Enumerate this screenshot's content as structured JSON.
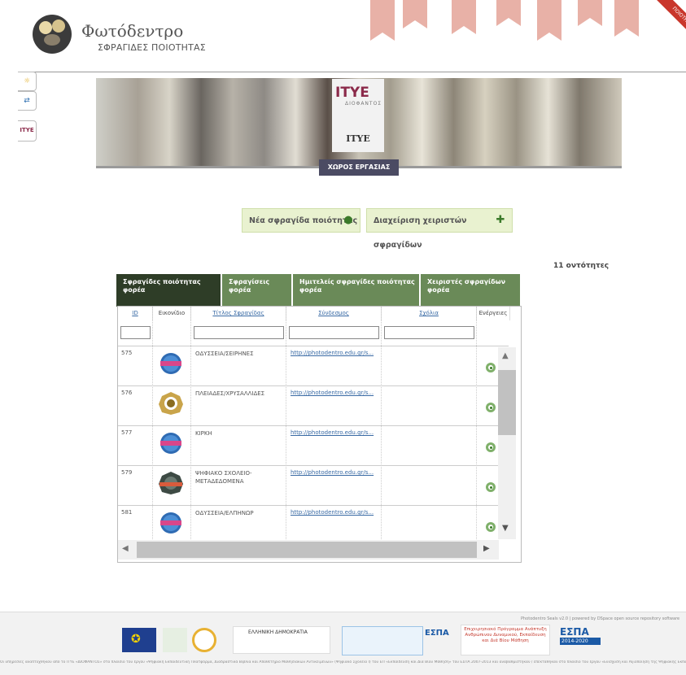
{
  "header": {
    "site_title": "Φωτόδεντρο",
    "site_subtitle": "ΣΦΡΑΓΙΔΕΣ ΠΟΙΟΤΗΤΑΣ",
    "corner_label": "ΠΟΙΟΤΗΤΑ"
  },
  "side_tabs": [
    {
      "icon": "sun-icon"
    },
    {
      "icon": "exchange-icon"
    },
    {
      "label": "ITYE"
    }
  ],
  "banner": {
    "logo_text": "ITYE",
    "logo_subtext": "ΔΙΟΦΑΝΤΟΣ",
    "name": "ITYE",
    "workspace_label": "ΧΩΡΟΣ ΕΡΓΑΣΙΑΣ"
  },
  "actions": {
    "new_seal": "Νέα σφραγίδα ποιότητας",
    "manage_users": "Διαχείριση χειριστών σφραγίδων"
  },
  "count_label": "11 οντότητες",
  "tabs": [
    "Σφραγίδες ποιότητας φορέα",
    "Σφραγίσεις φορέα",
    "Ημιτελείς σφραγίδες ποιότητας φορέα",
    "Χειριστές σφραγίδων φορέα"
  ],
  "grid": {
    "columns": [
      "ID",
      "Εικονίδιο",
      "Τίτλος Σφραγίδας",
      "Σύνδεσμος",
      "Σχόλια",
      "Ενέργειες"
    ],
    "rows": [
      {
        "id": "575",
        "title": "ΟΔΥΣΣΕΙΑ/ΣΕΙΡΗΝΕΣ",
        "link": "http://photodentro.edu.gr/s...",
        "badge": "blue"
      },
      {
        "id": "576",
        "title": "ΠΛΕΙΑΔΕΣ/ΧΡΥΣΑΛΛΙΔΕΣ",
        "link": "http://photodentro.edu.gr/s...",
        "badge": "gold"
      },
      {
        "id": "577",
        "title": "ΚΙΡΚΗ",
        "link": "http://photodentro.edu.gr/s...",
        "badge": "blue"
      },
      {
        "id": "579",
        "title": "ΨΗΦΙΑΚΟ ΣΧΟΛΕΙΟ-ΜΕΤΑΔΕΔΟΜΕΝΑ",
        "link": "http://photodentro.edu.gr/s...",
        "badge": "dark"
      },
      {
        "id": "581",
        "title": "ΟΔΥΣΣΕΙΑ/ΕΛΠΗΝΩΡ",
        "link": "http://photodentro.edu.gr/s...",
        "badge": "blue"
      }
    ]
  },
  "footer": {
    "powered_by": "Photodentro Seals v2.0 | powered by DSpace open source repository software",
    "logo_espa": "ΕΣΠΑ",
    "logo_espa_years": "2014-2020",
    "logo_hellenic": "ΕΛΛΗΝΙΚΗ ΔΗΜΟΚΡΑΤΙΑ",
    "logo_program": "Επιχειρησιακό Πρόγραμμα Ανάπτυξη Ανθρώπινου Δυναμικού, Εκπαίδευση και Διά Βίου Μάθηση",
    "text": "Οι υπηρεσίες αναπτύχθηκαν από το ΙΤΥΕ «ΔΙΟΦΑΝΤΟΣ» στο πλαίσιο του έργου «Ψηφιακή Εκπαιδευτική Πλατφόρμα, Διαδραστικά Βιβλία και Αποθετήριο Μαθησιακών Αντικειμένων» (Ψηφιακό Σχολείο I) του ΕΠ «Εκπαίδευση και Διά Βίου Μάθηση» του ΕΣΠΑ 2007-2013 και αναβαθμίστηκαν / επεκτάθηκαν στο πλαίσιο του έργου «Ενίσχυση και Αξιοποίηση της Ψηφιακής Εκπαιδευτικής Πλατφόρμας, των Διαδραστικών Βιβλίων και του Αποθετηρίου Μαθησιακών Αντικειμένων» (Ψηφιακό Σχολείο II) του ΕΠ «Ανάπτυξη Ανθρώπινου Δυναμικού, Εκπαίδευση και Διά Βίου Μάθηση» του ΕΣΠΑ 2014-2020, με τη συγχρηματοδότηση από την Ευρωπαϊκή Ένωση (ΕΚΤ) και το Ελληνικό Δημόσιο."
  }
}
